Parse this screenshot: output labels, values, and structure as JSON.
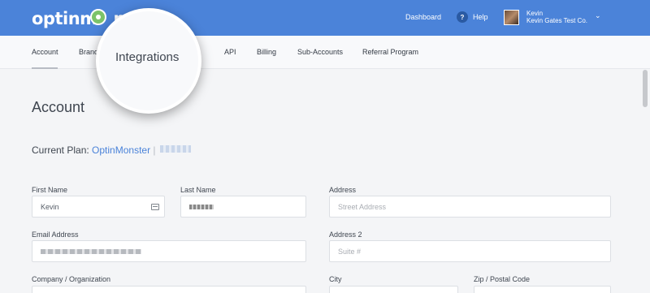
{
  "header": {
    "logo_text": "optinm",
    "logo_rest": "nster",
    "nav_dashboard": "Dashboard",
    "help_label": "Help",
    "help_icon_glyph": "?",
    "user_name": "Kevin",
    "user_org": "Kevin Gates Test Co.",
    "user_chevron": "⌄",
    "bar_color": "#4b83d9"
  },
  "tabs": {
    "account": "Account",
    "branding_partial": "Brand",
    "api": "API",
    "billing": "Billing",
    "sub_accounts": "Sub-Accounts",
    "referral": "Referral Program"
  },
  "magnifier": {
    "label": "Integrations"
  },
  "main": {
    "title": "Account",
    "plan_label": "Current Plan:",
    "plan_name": "OptinMonster",
    "plan_separator": "|"
  },
  "form": {
    "first_name_label": "First Name",
    "first_name_value": "Kevin",
    "last_name_label": "Last Name",
    "address_label": "Address",
    "address_placeholder": "Street Address",
    "email_label": "Email Address",
    "address2_label": "Address 2",
    "address2_placeholder": "Suite #",
    "company_label": "Company / Organization",
    "city_label": "City",
    "zip_label": "Zip / Postal Code"
  }
}
